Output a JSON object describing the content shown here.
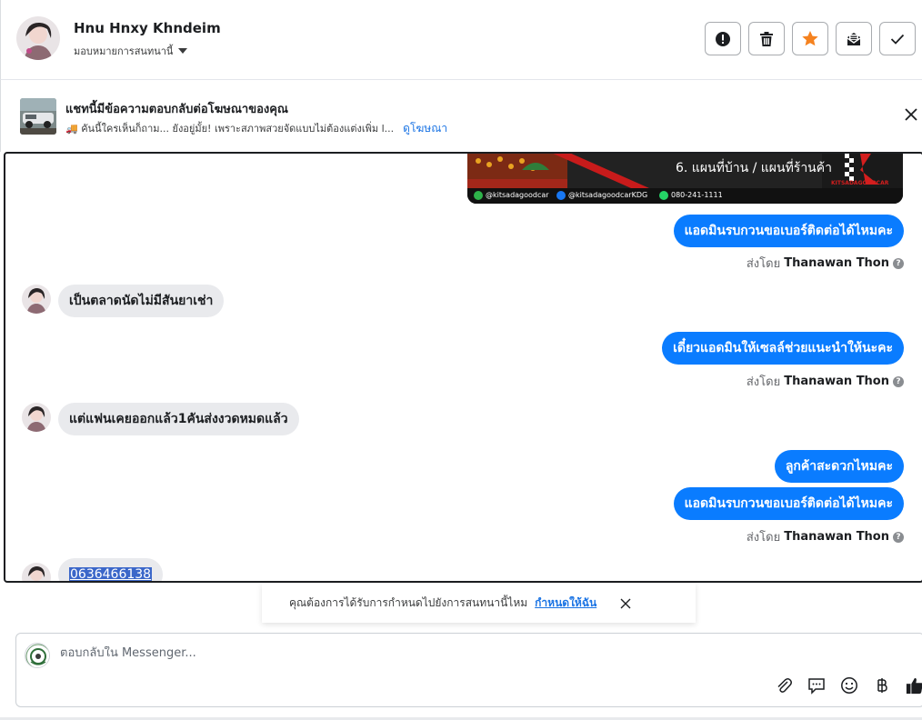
{
  "header": {
    "contact_name": "Hnu Hnxy Khndeim",
    "assign_label": "มอบหมายการสนทนานี้",
    "actions": [
      {
        "name": "mark-spam",
        "icon": "alert-icon"
      },
      {
        "name": "delete",
        "icon": "trash-icon"
      },
      {
        "name": "star",
        "icon": "star-icon"
      },
      {
        "name": "mark-unread",
        "icon": "envelope-icon"
      },
      {
        "name": "mark-done",
        "icon": "check-icon"
      }
    ],
    "star_color": "#f5821f"
  },
  "ad_banner": {
    "title": "แชทนี้มีข้อความตอบกลับต่อโฆษณาของคุณ",
    "snippet": "🚚 คันนี้ใครเห็นก็ถาม... ยังอยู่มั้ย! เพราะสภาพสวยจัดแบบไม่ต้องแต่งเพิ่ม l...",
    "link_label": "ดูโฆษณา"
  },
  "conversation": {
    "ad_image": {
      "caption": "6. แผนที่บ้าน / แผนที่ร้านค้า",
      "footer_line": "@kitsadagoodcar",
      "footer_fb": "@kitsadagoodcarKDG",
      "footer_phone": "080-241-1111",
      "brand": "KITSADAGOODCAR"
    },
    "messages": [
      {
        "dir": "out",
        "text": "แอดมินรบกวนขอเบอร์ติดต่อได้ไหมคะ"
      },
      {
        "dir": "in",
        "text": "เป็นตลาดนัดไม่มีสันยาเช่า"
      },
      {
        "dir": "out",
        "text": "เดี๋ยวแอดมินให้เซลล์ช่วยแนะนำให้นะคะ"
      },
      {
        "dir": "in",
        "text": "แต่แฟนเคยออกแล้ว1คันส่งงวดหมดแล้ว"
      },
      {
        "dir": "out",
        "text": "ลูกค้าสะดวกไหมคะ"
      },
      {
        "dir": "out",
        "text": "แอดมินรบกวนขอเบอร์ติดต่อได้ไหมคะ"
      },
      {
        "dir": "in",
        "text": "0636466138"
      }
    ],
    "sent_by_prefix": "ส่งโดย",
    "sent_by_name": "Thanawan Thon",
    "bubble_color": "#0a7cff"
  },
  "notice": {
    "text": "คุณต้องการได้รับการกำหนดไปยังการสนทนานี้ไหม",
    "link_label": "กำหนดให้ฉัน"
  },
  "composer": {
    "placeholder": "ตอบกลับใน Messenger...",
    "tools": [
      "paperclip-icon",
      "saved-reply-icon",
      "emoji-icon",
      "baht-icon",
      "thumbs-up-icon"
    ]
  }
}
